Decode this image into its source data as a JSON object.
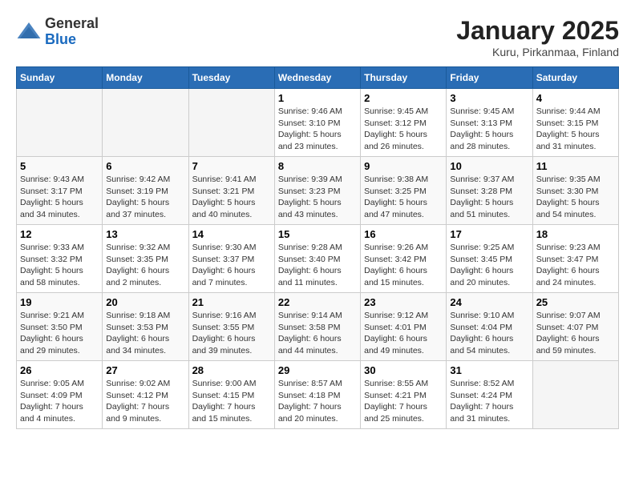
{
  "header": {
    "logo": {
      "line1": "General",
      "line2": "Blue"
    },
    "title": "January 2025",
    "location": "Kuru, Pirkanmaa, Finland"
  },
  "weekdays": [
    "Sunday",
    "Monday",
    "Tuesday",
    "Wednesday",
    "Thursday",
    "Friday",
    "Saturday"
  ],
  "weeks": [
    [
      {
        "day": "",
        "info": ""
      },
      {
        "day": "",
        "info": ""
      },
      {
        "day": "",
        "info": ""
      },
      {
        "day": "1",
        "info": "Sunrise: 9:46 AM\nSunset: 3:10 PM\nDaylight: 5 hours\nand 23 minutes."
      },
      {
        "day": "2",
        "info": "Sunrise: 9:45 AM\nSunset: 3:12 PM\nDaylight: 5 hours\nand 26 minutes."
      },
      {
        "day": "3",
        "info": "Sunrise: 9:45 AM\nSunset: 3:13 PM\nDaylight: 5 hours\nand 28 minutes."
      },
      {
        "day": "4",
        "info": "Sunrise: 9:44 AM\nSunset: 3:15 PM\nDaylight: 5 hours\nand 31 minutes."
      }
    ],
    [
      {
        "day": "5",
        "info": "Sunrise: 9:43 AM\nSunset: 3:17 PM\nDaylight: 5 hours\nand 34 minutes."
      },
      {
        "day": "6",
        "info": "Sunrise: 9:42 AM\nSunset: 3:19 PM\nDaylight: 5 hours\nand 37 minutes."
      },
      {
        "day": "7",
        "info": "Sunrise: 9:41 AM\nSunset: 3:21 PM\nDaylight: 5 hours\nand 40 minutes."
      },
      {
        "day": "8",
        "info": "Sunrise: 9:39 AM\nSunset: 3:23 PM\nDaylight: 5 hours\nand 43 minutes."
      },
      {
        "day": "9",
        "info": "Sunrise: 9:38 AM\nSunset: 3:25 PM\nDaylight: 5 hours\nand 47 minutes."
      },
      {
        "day": "10",
        "info": "Sunrise: 9:37 AM\nSunset: 3:28 PM\nDaylight: 5 hours\nand 51 minutes."
      },
      {
        "day": "11",
        "info": "Sunrise: 9:35 AM\nSunset: 3:30 PM\nDaylight: 5 hours\nand 54 minutes."
      }
    ],
    [
      {
        "day": "12",
        "info": "Sunrise: 9:33 AM\nSunset: 3:32 PM\nDaylight: 5 hours\nand 58 minutes."
      },
      {
        "day": "13",
        "info": "Sunrise: 9:32 AM\nSunset: 3:35 PM\nDaylight: 6 hours\nand 2 minutes."
      },
      {
        "day": "14",
        "info": "Sunrise: 9:30 AM\nSunset: 3:37 PM\nDaylight: 6 hours\nand 7 minutes."
      },
      {
        "day": "15",
        "info": "Sunrise: 9:28 AM\nSunset: 3:40 PM\nDaylight: 6 hours\nand 11 minutes."
      },
      {
        "day": "16",
        "info": "Sunrise: 9:26 AM\nSunset: 3:42 PM\nDaylight: 6 hours\nand 15 minutes."
      },
      {
        "day": "17",
        "info": "Sunrise: 9:25 AM\nSunset: 3:45 PM\nDaylight: 6 hours\nand 20 minutes."
      },
      {
        "day": "18",
        "info": "Sunrise: 9:23 AM\nSunset: 3:47 PM\nDaylight: 6 hours\nand 24 minutes."
      }
    ],
    [
      {
        "day": "19",
        "info": "Sunrise: 9:21 AM\nSunset: 3:50 PM\nDaylight: 6 hours\nand 29 minutes."
      },
      {
        "day": "20",
        "info": "Sunrise: 9:18 AM\nSunset: 3:53 PM\nDaylight: 6 hours\nand 34 minutes."
      },
      {
        "day": "21",
        "info": "Sunrise: 9:16 AM\nSunset: 3:55 PM\nDaylight: 6 hours\nand 39 minutes."
      },
      {
        "day": "22",
        "info": "Sunrise: 9:14 AM\nSunset: 3:58 PM\nDaylight: 6 hours\nand 44 minutes."
      },
      {
        "day": "23",
        "info": "Sunrise: 9:12 AM\nSunset: 4:01 PM\nDaylight: 6 hours\nand 49 minutes."
      },
      {
        "day": "24",
        "info": "Sunrise: 9:10 AM\nSunset: 4:04 PM\nDaylight: 6 hours\nand 54 minutes."
      },
      {
        "day": "25",
        "info": "Sunrise: 9:07 AM\nSunset: 4:07 PM\nDaylight: 6 hours\nand 59 minutes."
      }
    ],
    [
      {
        "day": "26",
        "info": "Sunrise: 9:05 AM\nSunset: 4:09 PM\nDaylight: 7 hours\nand 4 minutes."
      },
      {
        "day": "27",
        "info": "Sunrise: 9:02 AM\nSunset: 4:12 PM\nDaylight: 7 hours\nand 9 minutes."
      },
      {
        "day": "28",
        "info": "Sunrise: 9:00 AM\nSunset: 4:15 PM\nDaylight: 7 hours\nand 15 minutes."
      },
      {
        "day": "29",
        "info": "Sunrise: 8:57 AM\nSunset: 4:18 PM\nDaylight: 7 hours\nand 20 minutes."
      },
      {
        "day": "30",
        "info": "Sunrise: 8:55 AM\nSunset: 4:21 PM\nDaylight: 7 hours\nand 25 minutes."
      },
      {
        "day": "31",
        "info": "Sunrise: 8:52 AM\nSunset: 4:24 PM\nDaylight: 7 hours\nand 31 minutes."
      },
      {
        "day": "",
        "info": ""
      }
    ]
  ]
}
